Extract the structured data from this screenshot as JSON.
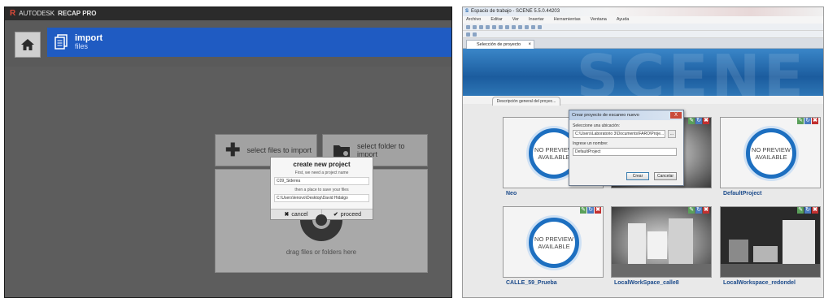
{
  "recap": {
    "brand_prefix": "AUTODESK",
    "product_name": "RECAP PRO",
    "import": {
      "title": "import",
      "subtitle": "files"
    },
    "select_files_label": "select files to import",
    "select_folder_label": "select folder to import",
    "drop_caption": "drag files or folders here",
    "new_project": {
      "title": "create new project",
      "name_hint": "First, we need a project name",
      "name_value": "C09_Siderea",
      "location_hint": "then a place to save your files",
      "location_value": "C:\\Users\\lenovo\\Desktop\\David Hidalgo",
      "cancel_label": "cancel",
      "proceed_label": "proceed"
    }
  },
  "scene": {
    "window_title": "Espacio de trabajo - SCENE 5.5.0.44203",
    "menu": [
      "Archivo",
      "Editar",
      "Ver",
      "Insertar",
      "Herramientas",
      "Ventana",
      "Ayuda"
    ],
    "tab_label": "Selección de proyecto",
    "tab_close": "×",
    "subtab_label": "Descripción general del proyec...",
    "banner_word": "SCENE",
    "no_preview": "NO PREVIEW AVAILABLE",
    "projects": [
      {
        "name": "Neo"
      },
      {
        "name": "DefaultProject"
      },
      {
        "name": "CALLE_59_Prueba"
      },
      {
        "name": "LocalWorkSpace_calle8"
      },
      {
        "name": "LocalWorkspace_redondel"
      }
    ],
    "dialog": {
      "title": "Crear proyecto de escaneo nuevo",
      "close": "X",
      "location_label": "Seleccione una ubicación:",
      "location_value": "C:\\Users\\Laboratorio 3\\Documents\\FARO\\Proje...",
      "browse": "...",
      "name_label": "Ingrese un nombre:",
      "name_value": "DefaultProject",
      "create_label": "Crear",
      "cancel_label": "Cancelar"
    }
  }
}
